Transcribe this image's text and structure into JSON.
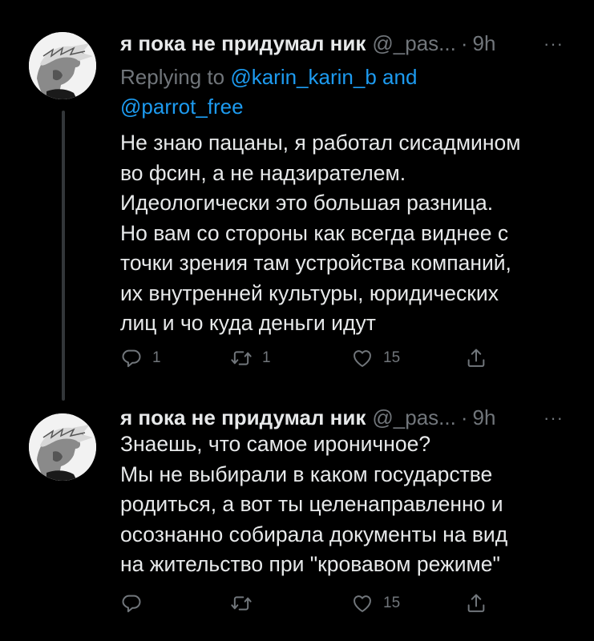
{
  "tweets": [
    {
      "display_name": "я пока не придумал ник",
      "handle": "@_pas...",
      "separator": "·",
      "time": "9h",
      "more_label": "···",
      "replying": {
        "prefix": "Replying to",
        "mention_1": "@karin_karin_b",
        "conjunction": "and",
        "mention_2": "@parrot_free"
      },
      "text_lines": [
        "Не знаю пацаны, я работал сисадмином",
        "во фсин, а не надзирателем.",
        "Идеологически это большая разница.",
        "Но вам со стороны как всегда виднее с",
        "точки зрения там устройства компаний,",
        "их внутренней культуры, юридических",
        "лиц и чо куда деньги идут"
      ],
      "actions": {
        "reply_count": "1",
        "retweet_count": "1",
        "like_count": "15",
        "reply_icon": "reply-icon",
        "retweet_icon": "retweet-icon",
        "like_icon": "heart-icon",
        "share_icon": "share-icon"
      }
    },
    {
      "display_name": "я пока не придумал ник",
      "handle": "@_pas...",
      "separator": "·",
      "time": "9h",
      "more_label": "···",
      "text_lines": [
        "Знаешь, что самое ироничное?",
        "Мы не выбирали в каком государстве",
        "родиться, а вот ты целенаправленно и",
        "осознанно собирала документы на вид",
        "на жительство при \"кровавом режиме\""
      ],
      "actions": {
        "reply_count": "",
        "retweet_count": "",
        "like_count": "15",
        "reply_icon": "reply-icon",
        "retweet_icon": "retweet-icon",
        "like_icon": "heart-icon",
        "share_icon": "share-icon"
      }
    }
  ],
  "colors": {
    "background": "#000000",
    "text_primary": "#e7e9ea",
    "text_secondary": "#71767b",
    "link": "#1d9bf0",
    "thread_line": "#333639"
  }
}
